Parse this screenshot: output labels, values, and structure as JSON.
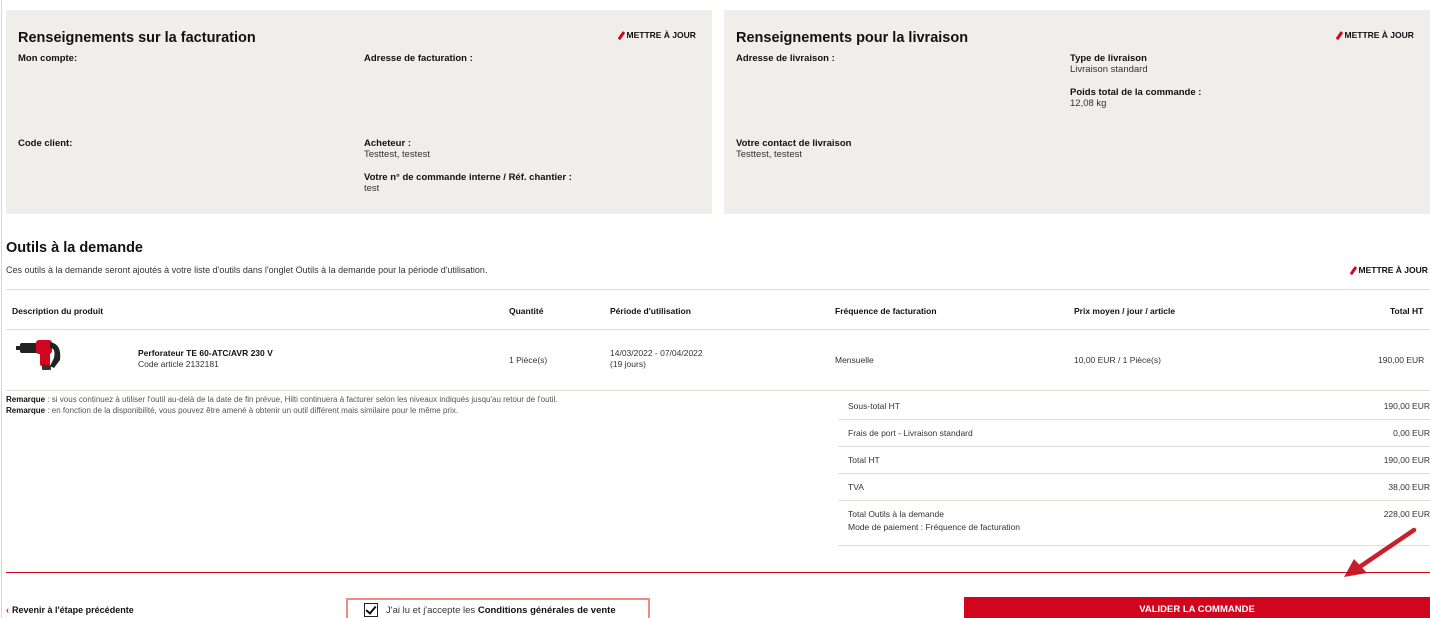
{
  "billing": {
    "title": "Renseignements sur la facturation",
    "update_label": "METTRE À JOUR",
    "account_label": "Mon compte:",
    "client_code_label": "Code client:",
    "billing_address_label": "Adresse de facturation :",
    "buyer_label": "Acheteur :",
    "buyer_value": "Testtest, testest",
    "order_ref_label": "Votre n° de commande interne / Réf. chantier :",
    "order_ref_value": "test"
  },
  "delivery": {
    "title": "Renseignements pour la livraison",
    "update_label": "METTRE À JOUR",
    "address_label": "Adresse de livraison :",
    "type_label": "Type de livraison",
    "type_value": "Livraison standard",
    "weight_label": "Poids total de la commande :",
    "weight_value": "12,08 kg",
    "contact_label": "Votre contact de livraison",
    "contact_value": "Testtest, testest"
  },
  "tools": {
    "title": "Outils à la demande",
    "description": "Ces outils à la demande seront ajoutés à votre liste d'outils dans l'onglet Outils à la demande pour la période d'utilisation.",
    "update_label": "METTRE À JOUR",
    "columns": {
      "product": "Description du produit",
      "quantity": "Quantité",
      "period": "Période d'utilisation",
      "frequency": "Fréquence de facturation",
      "avg_price": "Prix moyen / jour / article",
      "total": "Total HT"
    },
    "item": {
      "name": "Perforateur TE 60-ATC/AVR 230 V",
      "code": "Code article 2132181",
      "quantity": "1 Pièce(s)",
      "period": "14/03/2022 - 07/04/2022",
      "days": "(19 jours)",
      "frequency": "Mensuelle",
      "avg_price": "10,00 EUR / 1 Pièce(s)",
      "total": "190,00 EUR"
    }
  },
  "remarks": [
    {
      "label": "Remarque",
      "text": " : si vous continuez à utiliser l'outil au-delà de la date de fin prévue, Hilti continuera à facturer selon les niveaux indiqués jusqu'au retour de l'outil."
    },
    {
      "label": "Remarque",
      "text": " : en fonction de la disponibilité, vous pouvez être amené à obtenir un outil différent mais similaire pour le même prix."
    }
  ],
  "summary": {
    "subtotal_label": "Sous-total HT",
    "subtotal_value": "190,00 EUR",
    "shipping_label": "Frais de port - Livraison standard",
    "shipping_value": "0,00 EUR",
    "total_ht_label": "Total HT",
    "total_ht_value": "190,00 EUR",
    "vat_label": "TVA",
    "vat_value": "38,00 EUR",
    "grand_total_label": "Total Outils à la demande",
    "grand_total_value": "228,00 EUR",
    "payment_mode": "Mode de paiement : Fréquence de facturation"
  },
  "footer": {
    "back_label": "Revenir à l'étape précédente",
    "terms_prefix": "J'ai lu et j'accepte les ",
    "terms_link": "Conditions générales de vente",
    "validate_label": "VALIDER LA COMMANDE"
  },
  "colors": {
    "brand_red": "#d2051e",
    "panel_bg": "#f0eeea"
  }
}
